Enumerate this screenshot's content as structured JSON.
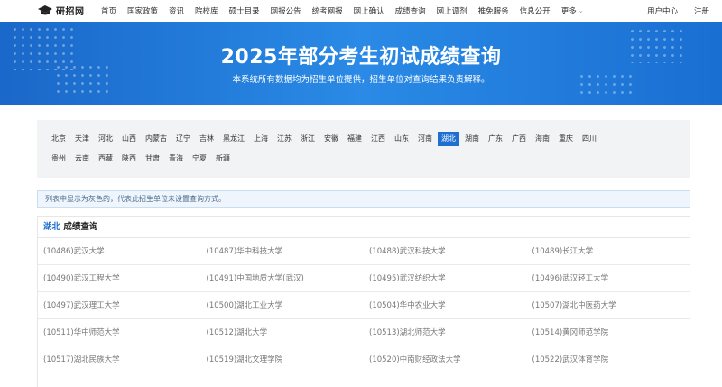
{
  "nav": {
    "logo_text": "研招网",
    "links": [
      "首页",
      "国家政策",
      "资讯",
      "院校库",
      "硕士目录",
      "网报公告",
      "统考网报",
      "网上确认",
      "成绩查询",
      "网上调剂",
      "推免服务",
      "信息公开",
      "更多"
    ],
    "user_center": "用户中心",
    "register": "注册"
  },
  "banner": {
    "title": "2025年部分考生初试成绩查询",
    "subtitle": "本系统所有数据均为招生单位提供，招生单位对查询结果负责解释。"
  },
  "provinces": {
    "row1": [
      "北京",
      "天津",
      "河北",
      "山西",
      "内蒙古",
      "辽宁",
      "吉林",
      "黑龙江",
      "上海",
      "江苏",
      "浙江",
      "安徽",
      "福建",
      "江西",
      "山东",
      "河南",
      "湖北",
      "湖南",
      "广东",
      "广西",
      "海南",
      "重庆",
      "四川"
    ],
    "row2": [
      "贵州",
      "云南",
      "西藏",
      "陕西",
      "甘肃",
      "青海",
      "宁夏",
      "新疆"
    ],
    "active": "湖北"
  },
  "notice": "列表中显示为灰色的，代表此招生单位未设置查询方式。",
  "results": {
    "province": "湖北",
    "heading_suffix": "成绩查询",
    "rows": [
      [
        "(10486)武汉大学",
        "(10487)华中科技大学",
        "(10488)武汉科技大学",
        "(10489)长江大学"
      ],
      [
        "(10490)武汉工程大学",
        "(10491)中国地质大学(武汉)",
        "(10495)武汉纺织大学",
        "(10496)武汉轻工大学"
      ],
      [
        "(10497)武汉理工大学",
        "(10500)湖北工业大学",
        "(10504)华中农业大学",
        "(10507)湖北中医药大学"
      ],
      [
        "(10511)华中师范大学",
        "(10512)湖北大学",
        "(10513)湖北师范大学",
        "(10514)黄冈师范学院"
      ],
      [
        "(10517)湖北民族大学",
        "(10519)湖北文理学院",
        "(10520)中南财经政法大学",
        "(10522)武汉体育学院"
      ]
    ]
  },
  "colors": {
    "accent": "#1e6fd0",
    "banner": "#2a8ae6"
  }
}
